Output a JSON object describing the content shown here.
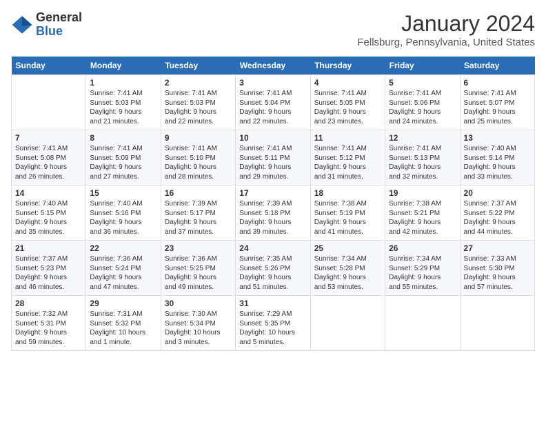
{
  "header": {
    "logo_general": "General",
    "logo_blue": "Blue",
    "month_title": "January 2024",
    "location": "Fellsburg, Pennsylvania, United States"
  },
  "days_of_week": [
    "Sunday",
    "Monday",
    "Tuesday",
    "Wednesday",
    "Thursday",
    "Friday",
    "Saturday"
  ],
  "weeks": [
    [
      {
        "day": "",
        "info": ""
      },
      {
        "day": "1",
        "info": "Sunrise: 7:41 AM\nSunset: 5:03 PM\nDaylight: 9 hours\nand 21 minutes."
      },
      {
        "day": "2",
        "info": "Sunrise: 7:41 AM\nSunset: 5:03 PM\nDaylight: 9 hours\nand 22 minutes."
      },
      {
        "day": "3",
        "info": "Sunrise: 7:41 AM\nSunset: 5:04 PM\nDaylight: 9 hours\nand 22 minutes."
      },
      {
        "day": "4",
        "info": "Sunrise: 7:41 AM\nSunset: 5:05 PM\nDaylight: 9 hours\nand 23 minutes."
      },
      {
        "day": "5",
        "info": "Sunrise: 7:41 AM\nSunset: 5:06 PM\nDaylight: 9 hours\nand 24 minutes."
      },
      {
        "day": "6",
        "info": "Sunrise: 7:41 AM\nSunset: 5:07 PM\nDaylight: 9 hours\nand 25 minutes."
      }
    ],
    [
      {
        "day": "7",
        "info": "Sunrise: 7:41 AM\nSunset: 5:08 PM\nDaylight: 9 hours\nand 26 minutes."
      },
      {
        "day": "8",
        "info": "Sunrise: 7:41 AM\nSunset: 5:09 PM\nDaylight: 9 hours\nand 27 minutes."
      },
      {
        "day": "9",
        "info": "Sunrise: 7:41 AM\nSunset: 5:10 PM\nDaylight: 9 hours\nand 28 minutes."
      },
      {
        "day": "10",
        "info": "Sunrise: 7:41 AM\nSunset: 5:11 PM\nDaylight: 9 hours\nand 29 minutes."
      },
      {
        "day": "11",
        "info": "Sunrise: 7:41 AM\nSunset: 5:12 PM\nDaylight: 9 hours\nand 31 minutes."
      },
      {
        "day": "12",
        "info": "Sunrise: 7:41 AM\nSunset: 5:13 PM\nDaylight: 9 hours\nand 32 minutes."
      },
      {
        "day": "13",
        "info": "Sunrise: 7:40 AM\nSunset: 5:14 PM\nDaylight: 9 hours\nand 33 minutes."
      }
    ],
    [
      {
        "day": "14",
        "info": "Sunrise: 7:40 AM\nSunset: 5:15 PM\nDaylight: 9 hours\nand 35 minutes."
      },
      {
        "day": "15",
        "info": "Sunrise: 7:40 AM\nSunset: 5:16 PM\nDaylight: 9 hours\nand 36 minutes."
      },
      {
        "day": "16",
        "info": "Sunrise: 7:39 AM\nSunset: 5:17 PM\nDaylight: 9 hours\nand 37 minutes."
      },
      {
        "day": "17",
        "info": "Sunrise: 7:39 AM\nSunset: 5:18 PM\nDaylight: 9 hours\nand 39 minutes."
      },
      {
        "day": "18",
        "info": "Sunrise: 7:38 AM\nSunset: 5:19 PM\nDaylight: 9 hours\nand 41 minutes."
      },
      {
        "day": "19",
        "info": "Sunrise: 7:38 AM\nSunset: 5:21 PM\nDaylight: 9 hours\nand 42 minutes."
      },
      {
        "day": "20",
        "info": "Sunrise: 7:37 AM\nSunset: 5:22 PM\nDaylight: 9 hours\nand 44 minutes."
      }
    ],
    [
      {
        "day": "21",
        "info": "Sunrise: 7:37 AM\nSunset: 5:23 PM\nDaylight: 9 hours\nand 46 minutes."
      },
      {
        "day": "22",
        "info": "Sunrise: 7:36 AM\nSunset: 5:24 PM\nDaylight: 9 hours\nand 47 minutes."
      },
      {
        "day": "23",
        "info": "Sunrise: 7:36 AM\nSunset: 5:25 PM\nDaylight: 9 hours\nand 49 minutes."
      },
      {
        "day": "24",
        "info": "Sunrise: 7:35 AM\nSunset: 5:26 PM\nDaylight: 9 hours\nand 51 minutes."
      },
      {
        "day": "25",
        "info": "Sunrise: 7:34 AM\nSunset: 5:28 PM\nDaylight: 9 hours\nand 53 minutes."
      },
      {
        "day": "26",
        "info": "Sunrise: 7:34 AM\nSunset: 5:29 PM\nDaylight: 9 hours\nand 55 minutes."
      },
      {
        "day": "27",
        "info": "Sunrise: 7:33 AM\nSunset: 5:30 PM\nDaylight: 9 hours\nand 57 minutes."
      }
    ],
    [
      {
        "day": "28",
        "info": "Sunrise: 7:32 AM\nSunset: 5:31 PM\nDaylight: 9 hours\nand 59 minutes."
      },
      {
        "day": "29",
        "info": "Sunrise: 7:31 AM\nSunset: 5:32 PM\nDaylight: 10 hours\nand 1 minute."
      },
      {
        "day": "30",
        "info": "Sunrise: 7:30 AM\nSunset: 5:34 PM\nDaylight: 10 hours\nand 3 minutes."
      },
      {
        "day": "31",
        "info": "Sunrise: 7:29 AM\nSunset: 5:35 PM\nDaylight: 10 hours\nand 5 minutes."
      },
      {
        "day": "",
        "info": ""
      },
      {
        "day": "",
        "info": ""
      },
      {
        "day": "",
        "info": ""
      }
    ]
  ]
}
